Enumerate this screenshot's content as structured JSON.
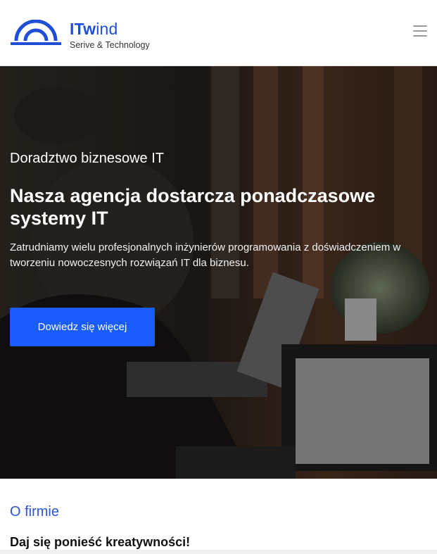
{
  "header": {
    "brand_bold": "ITw",
    "brand_light": "ind",
    "tagline": "Serive & Technology",
    "menu_icon": "hamburger-icon"
  },
  "hero": {
    "kicker": "Doradztwo biznesowe IT",
    "title": "Nasza agencja dostarcza ponadczasowe systemy IT",
    "lead": "Zatrudniamy wielu profesjonalnych inżynierów programowania z doświadczeniem w tworzeniu nowoczesnych rozwiązań IT dla biznesu.",
    "cta_label": "Dowiedz się więcej"
  },
  "about": {
    "label": "O firmie",
    "title": "Daj się ponieść kreatywności!"
  },
  "colors": {
    "accent": "#1a5cff",
    "brand": "#1f4fd6"
  }
}
